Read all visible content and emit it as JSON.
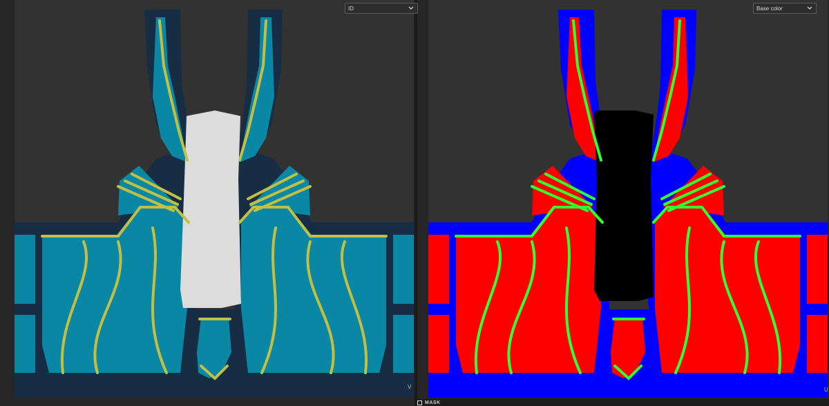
{
  "left_view": {
    "channel_select": {
      "value": "ID"
    },
    "colors": {
      "bg": "#323232",
      "fill": "#0987a4",
      "outline": "#162d44",
      "seam": "#c3bf43",
      "center": "#dcdcdc"
    }
  },
  "right_view": {
    "channel_select": {
      "value": "Base color"
    },
    "colors": {
      "bg": "#323232",
      "fill": "#ff0000",
      "outline": "#0000ff",
      "seam": "#30ff30",
      "center": "#000000"
    }
  },
  "bottom_bar": {
    "mask_label": "MASK"
  },
  "axis_markers": {
    "left": "V",
    "right": "U"
  }
}
